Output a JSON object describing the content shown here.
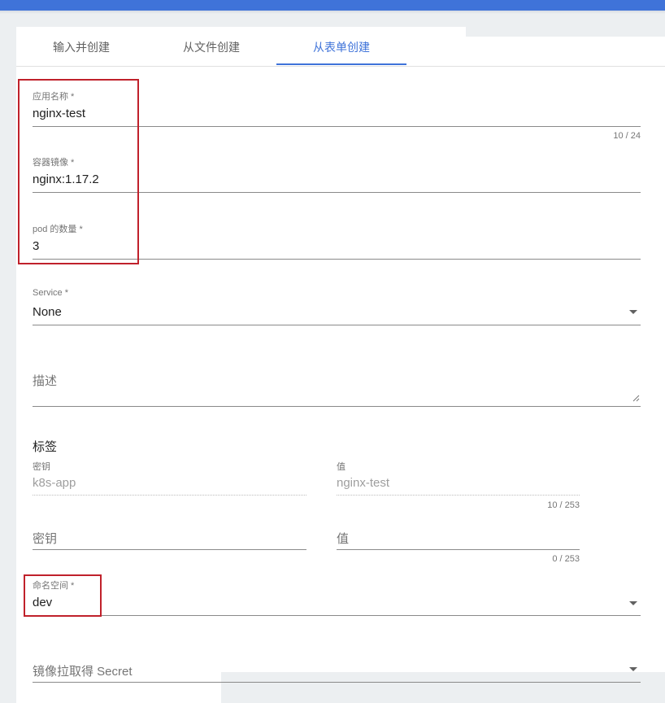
{
  "tabs": [
    {
      "label": "输入并创建"
    },
    {
      "label": "从文件创建"
    },
    {
      "label": "从表单创建"
    }
  ],
  "form": {
    "app_name": {
      "label": "应用名称 *",
      "value": "nginx-test",
      "counter": "10 / 24"
    },
    "container_image": {
      "label": "容器镜像 *",
      "value": "nginx:1.17.2"
    },
    "pod_count": {
      "label": "pod 的数量 *",
      "value": "3"
    },
    "service": {
      "label": "Service *",
      "value": "None"
    },
    "description": {
      "placeholder": "描述"
    },
    "labels": {
      "heading": "标签",
      "existing": {
        "key_label": "密钥",
        "key_value": "k8s-app",
        "value_label": "值",
        "value_value": "nginx-test",
        "counter": "10 / 253"
      },
      "new": {
        "key_placeholder": "密钥",
        "value_placeholder": "值",
        "counter": "0 / 253"
      }
    },
    "namespace": {
      "label": "命名空间 *",
      "value": "dev"
    },
    "image_pull_secret": {
      "placeholder": "镜像拉取得 Secret"
    }
  },
  "colors": {
    "accent": "#3f73d9",
    "highlight": "#c0212b"
  }
}
